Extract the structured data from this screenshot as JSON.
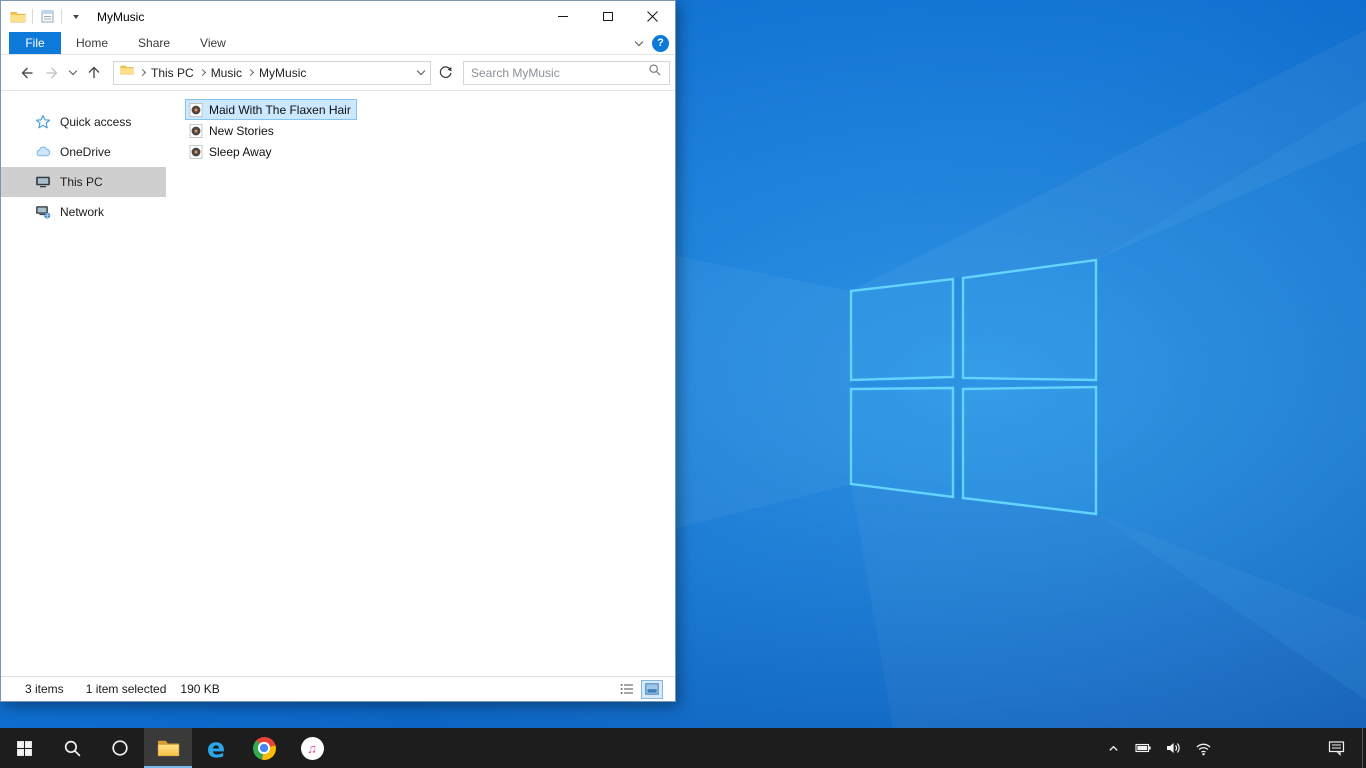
{
  "colors": {
    "accent_blue": "#0d79d8",
    "selection_fill": "#cce8ff",
    "selection_border": "#84c3f2",
    "sidebar_selected": "#cfcfcf",
    "taskbar_bg": "#1d1d1d",
    "desktop_blue": "#0e6ecf",
    "logo_cyan": "#63d3ff"
  },
  "window": {
    "title": "MyMusic",
    "ribbon": {
      "file_tab": "File",
      "tabs": [
        "Home",
        "Share",
        "View"
      ],
      "help_glyph": "?"
    },
    "navigation": {
      "breadcrumb": [
        "This PC",
        "Music",
        "MyMusic"
      ],
      "search_placeholder": "Search MyMusic"
    },
    "sidebar": [
      {
        "label": "Quick access",
        "icon": "quick-access-star-icon",
        "selected": false
      },
      {
        "label": "OneDrive",
        "icon": "onedrive-cloud-icon",
        "selected": false
      },
      {
        "label": "This PC",
        "icon": "this-pc-icon",
        "selected": true
      },
      {
        "label": "Network",
        "icon": "network-icon",
        "selected": false
      }
    ],
    "files": [
      {
        "name": "Maid With The Flaxen Hair",
        "icon": "audio-file-icon",
        "selected": true
      },
      {
        "name": "New Stories",
        "icon": "audio-file-icon",
        "selected": false
      },
      {
        "name": "Sleep Away",
        "icon": "audio-file-icon",
        "selected": false
      }
    ],
    "status_bar": {
      "items_count": "3 items",
      "selected_summary": "1 item selected",
      "selected_size": "190 KB"
    }
  },
  "taskbar": {
    "edge_glyph": "e",
    "itunes_glyph": "♫",
    "apps": [
      {
        "name": "start",
        "icon": "windows-start-icon",
        "active": false
      },
      {
        "name": "search",
        "icon": "search-icon",
        "active": false
      },
      {
        "name": "cortana",
        "icon": "cortana-icon",
        "active": false
      },
      {
        "name": "file-explorer",
        "icon": "file-explorer-icon",
        "active": true
      },
      {
        "name": "edge",
        "icon": "edge-icon",
        "active": false
      },
      {
        "name": "chrome",
        "icon": "chrome-icon",
        "active": false
      },
      {
        "name": "itunes",
        "icon": "itunes-icon",
        "active": false
      }
    ],
    "tray": [
      {
        "name": "hidden-icons",
        "icon": "chevron-up-icon"
      },
      {
        "name": "battery",
        "icon": "battery-icon"
      },
      {
        "name": "volume",
        "icon": "volume-icon"
      },
      {
        "name": "network",
        "icon": "wifi-icon"
      },
      {
        "name": "action-center",
        "icon": "action-center-icon"
      }
    ]
  }
}
